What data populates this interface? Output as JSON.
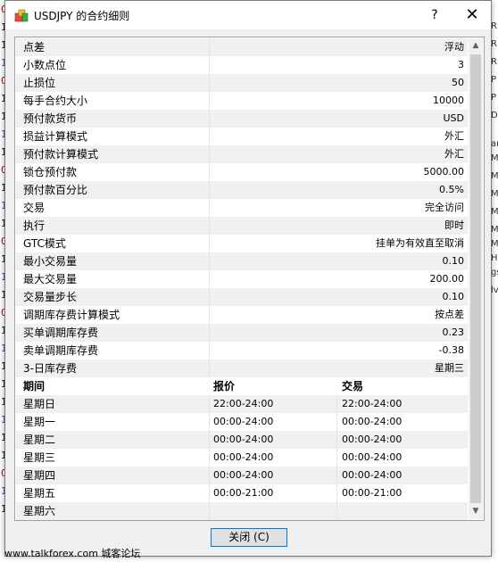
{
  "window": {
    "title": "USDJPY 的合约细则",
    "help_label": "?",
    "close_label": "✕"
  },
  "properties": [
    {
      "label": "点差",
      "value": "浮动"
    },
    {
      "label": "小数点位",
      "value": "3"
    },
    {
      "label": "止损位",
      "value": "50"
    },
    {
      "label": "每手合约大小",
      "value": "10000"
    },
    {
      "label": "预付款货币",
      "value": "USD"
    },
    {
      "label": "损益计算模式",
      "value": "外汇"
    },
    {
      "label": "预付款计算模式",
      "value": "外汇"
    },
    {
      "label": "锁仓预付款",
      "value": "5000.00"
    },
    {
      "label": "预付款百分比",
      "value": "0.5%"
    },
    {
      "label": "交易",
      "value": "完全访问"
    },
    {
      "label": "执行",
      "value": "即时"
    },
    {
      "label": "GTC模式",
      "value": "挂单为有效直至取消"
    },
    {
      "label": "最小交易量",
      "value": "0.10"
    },
    {
      "label": "最大交易量",
      "value": "200.00"
    },
    {
      "label": "交易量步长",
      "value": "0.10"
    },
    {
      "label": "调期库存费计算模式",
      "value": "按点差"
    },
    {
      "label": "买单调期库存费",
      "value": "0.23"
    },
    {
      "label": "卖单调期库存费",
      "value": "-0.38"
    },
    {
      "label": "3-日库存费",
      "value": "星期三"
    }
  ],
  "sessions": {
    "headers": [
      "期间",
      "报价",
      "交易"
    ],
    "rows": [
      {
        "day": "星期日",
        "quote": "22:00-24:00",
        "trade": "22:00-24:00"
      },
      {
        "day": "星期一",
        "quote": "00:00-24:00",
        "trade": "00:00-24:00"
      },
      {
        "day": "星期二",
        "quote": "00:00-24:00",
        "trade": "00:00-24:00"
      },
      {
        "day": "星期三",
        "quote": "00:00-24:00",
        "trade": "00:00-24:00"
      },
      {
        "day": "星期四",
        "quote": "00:00-24:00",
        "trade": "00:00-24:00"
      },
      {
        "day": "星期五",
        "quote": "00:00-21:00",
        "trade": "00:00-21:00"
      },
      {
        "day": "星期六",
        "quote": "",
        "trade": ""
      }
    ]
  },
  "buttons": {
    "close": "关闭 (C)"
  },
  "footer": "www.talkforex.com 城客论坛",
  "background": {
    "left_digits": [
      "0",
      "1",
      "1",
      "1",
      "0",
      "1",
      "1",
      "1",
      "1",
      "0",
      "1",
      "1",
      "1",
      "0",
      "1",
      "1",
      "1",
      "0",
      "1",
      "1",
      "1",
      "1",
      "1",
      "1",
      "1",
      "1",
      "0",
      "1",
      "1"
    ],
    "right_labels": [
      "R",
      "R",
      "R",
      "P",
      "P",
      "D",
      "ar",
      "Ma",
      "Ma",
      "Ma",
      "Ma",
      "Ma",
      "Ma",
      "H",
      "gs",
      "lv"
    ]
  },
  "colors": {
    "accent": "#0078d7",
    "row_alt": "#f0f0f0",
    "dialog_bg": "#f0f0f0"
  }
}
